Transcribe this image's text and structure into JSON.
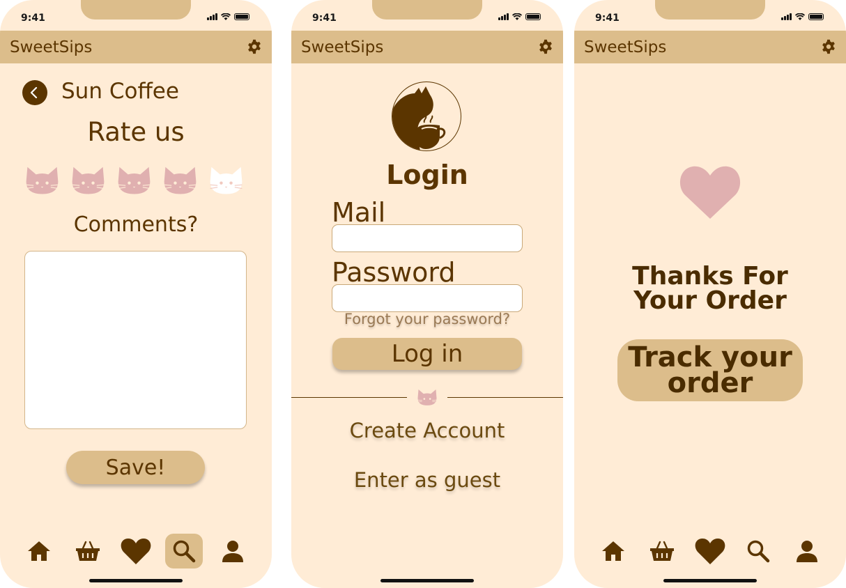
{
  "status": {
    "time": "9:41"
  },
  "app": {
    "title": "SweetSips"
  },
  "colors": {
    "background": "#ffecd6",
    "bar": "#dcbd8b",
    "brown": "#5b3500",
    "pink": "#e0b0b0"
  },
  "rating_screen": {
    "shop_name": "Sun Coffee",
    "title": "Rate us",
    "rating": {
      "value": 4,
      "max": 5,
      "icon": "cat-face-icon"
    },
    "comments_label": "Comments?",
    "comment_value": "",
    "save_label": "Save!",
    "active_nav": "search"
  },
  "login_screen": {
    "title": "Login",
    "mail_label": "Mail",
    "mail_value": "",
    "password_label": "Password",
    "password_value": "",
    "forgot_label": "Forgot your password?",
    "login_label": "Log in",
    "create_account_label": "Create Account",
    "guest_label": "Enter as guest"
  },
  "order_screen": {
    "thanks_line1": "Thanks For",
    "thanks_line2": "Your Order",
    "track_line1": "Track your",
    "track_line2": "order"
  },
  "nav": [
    "home-icon",
    "basket-icon",
    "heart-icon",
    "search-icon",
    "user-icon"
  ]
}
